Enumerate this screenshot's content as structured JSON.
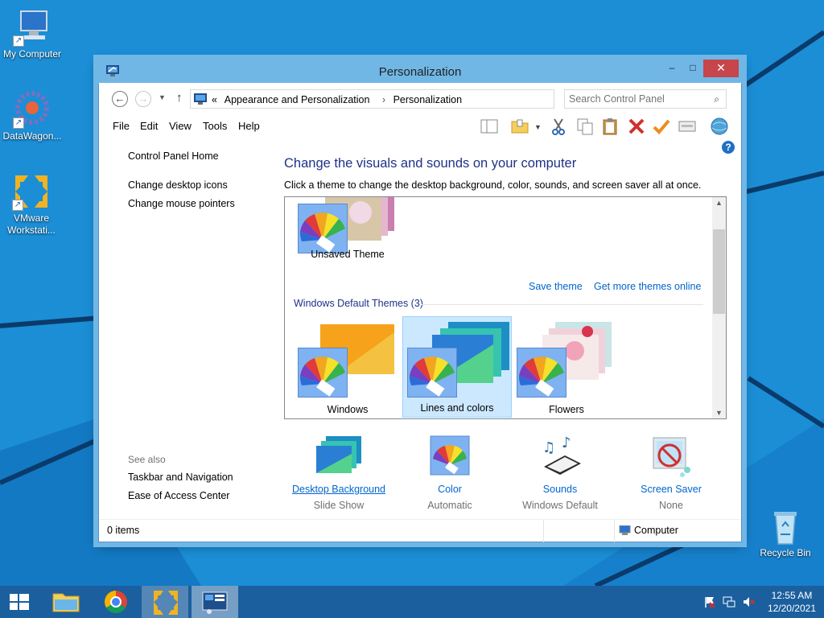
{
  "desktop": {
    "icons": [
      {
        "label": "My Computer"
      },
      {
        "label": "DataWagon..."
      },
      {
        "label": "VMware Workstati..."
      },
      {
        "label": "Recycle Bin"
      }
    ]
  },
  "window": {
    "title": "Personalization",
    "controls": {
      "minimize": "–",
      "maximize": "□",
      "close": "✕"
    }
  },
  "address": {
    "overflow": "«",
    "crumbs": [
      "Appearance and Personalization",
      "Personalization"
    ],
    "search_placeholder": "Search Control Panel"
  },
  "menu": [
    "File",
    "Edit",
    "View",
    "Tools",
    "Help"
  ],
  "leftnav": {
    "home": "Control Panel Home",
    "links": [
      "Change desktop icons",
      "Change mouse pointers"
    ],
    "see_also_label": "See also",
    "see_also": [
      "Taskbar and Navigation",
      "Ease of Access Center"
    ]
  },
  "main": {
    "heading": "Change the visuals and sounds on your computer",
    "subheading": "Click a theme to change the desktop background, color, sounds, and screen saver all at once.",
    "unsaved_theme": "Unsaved Theme",
    "save_theme": "Save theme",
    "get_more": "Get more themes online",
    "group_label": "Windows Default Themes (3)",
    "themes": [
      {
        "name": "Windows",
        "selected": false
      },
      {
        "name": "Lines and colors",
        "selected": true
      },
      {
        "name": "Flowers",
        "selected": false
      }
    ]
  },
  "options": [
    {
      "label": "Desktop Background",
      "value": "Slide Show",
      "icon": "desktop-background-icon"
    },
    {
      "label": "Color",
      "value": "Automatic",
      "icon": "color-icon"
    },
    {
      "label": "Sounds",
      "value": "Windows Default",
      "icon": "sounds-icon"
    },
    {
      "label": "Screen Saver",
      "value": "None",
      "icon": "screen-saver-icon"
    }
  ],
  "status": {
    "items": "0 items",
    "location": "Computer"
  },
  "taskbar": {
    "time": "12:55 AM",
    "date": "12/20/2021"
  },
  "colors": {
    "desktop": "#1b8ed6",
    "titlebar": "#70b7e6",
    "link": "#0066cc",
    "heading": "#1e3287",
    "selection": "#cce8ff"
  }
}
